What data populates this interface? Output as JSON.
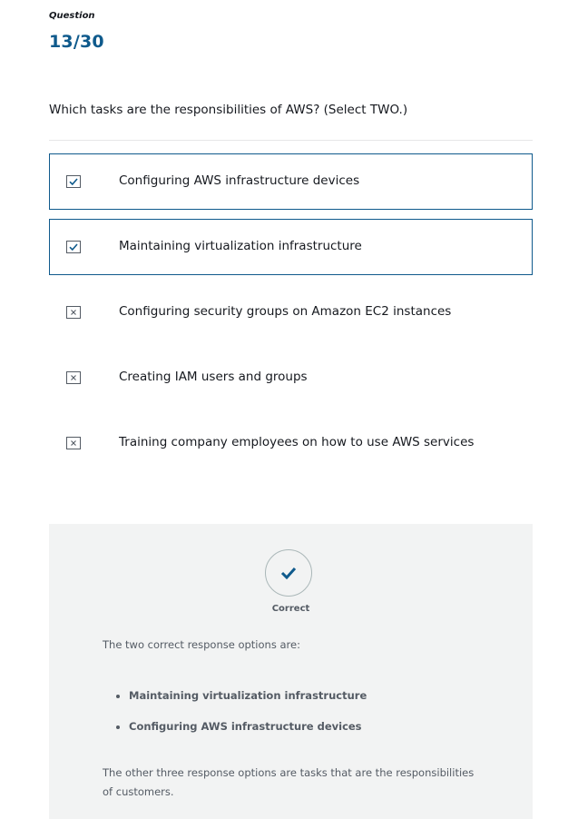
{
  "question": {
    "label": "Question",
    "number": "13/30",
    "text": "Which tasks are the responsibilities of AWS? (Select TWO.)"
  },
  "options": [
    {
      "label": "Configuring AWS infrastructure devices",
      "selected": true,
      "mark": "check"
    },
    {
      "label": "Maintaining virtualization infrastructure",
      "selected": true,
      "mark": "check"
    },
    {
      "label": "Configuring security groups on Amazon EC2 instances",
      "selected": false,
      "mark": "x"
    },
    {
      "label": "Creating IAM users and groups",
      "selected": false,
      "mark": "x"
    },
    {
      "label": "Training company employees on how to use AWS services",
      "selected": false,
      "mark": "x"
    }
  ],
  "feedback": {
    "status": "Correct",
    "status_icon": "check-icon",
    "intro": "The two correct response options are:",
    "correct_items": [
      "Maintaining virtualization infrastructure",
      "Configuring AWS infrastructure devices"
    ],
    "outro": "The other three response options are tasks that are the responsibilities of customers."
  },
  "colors": {
    "accent": "#0f5a8c",
    "feedback_bg": "#f2f3f3",
    "text": "#16191f",
    "muted": "#545b64"
  }
}
